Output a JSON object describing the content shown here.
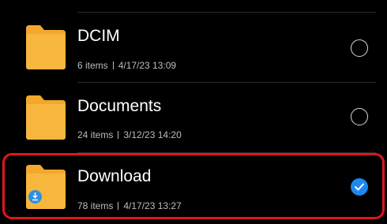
{
  "colors": {
    "background": "#000000",
    "folder": "#f7b73e",
    "folder_tab": "#f3a82b",
    "check_accent": "#1e88f0",
    "highlight_border": "#e0141e",
    "download_badge": "#2f8fe0"
  },
  "folders": [
    {
      "name": "DCIM",
      "item_count": "6 items",
      "date": "4/17/23 13:09",
      "selected": false,
      "icon": "folder-icon"
    },
    {
      "name": "Documents",
      "item_count": "24 items",
      "date": "3/12/23 14:20",
      "selected": false,
      "icon": "folder-icon"
    },
    {
      "name": "Download",
      "item_count": "78 items",
      "date": "4/17/23 13:27",
      "selected": true,
      "icon": "folder-download-icon"
    }
  ]
}
